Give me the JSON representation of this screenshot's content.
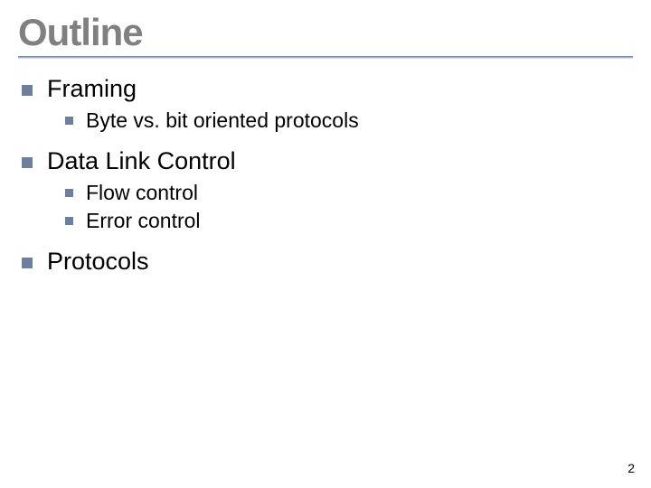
{
  "title": "Outline",
  "items": [
    {
      "label": "Framing",
      "children": [
        {
          "label": "Byte vs. bit oriented protocols"
        }
      ]
    },
    {
      "label": "Data Link Control",
      "children": [
        {
          "label": "Flow control"
        },
        {
          "label": "Error control"
        }
      ]
    },
    {
      "label": "Protocols",
      "children": []
    }
  ],
  "page_number": "2"
}
